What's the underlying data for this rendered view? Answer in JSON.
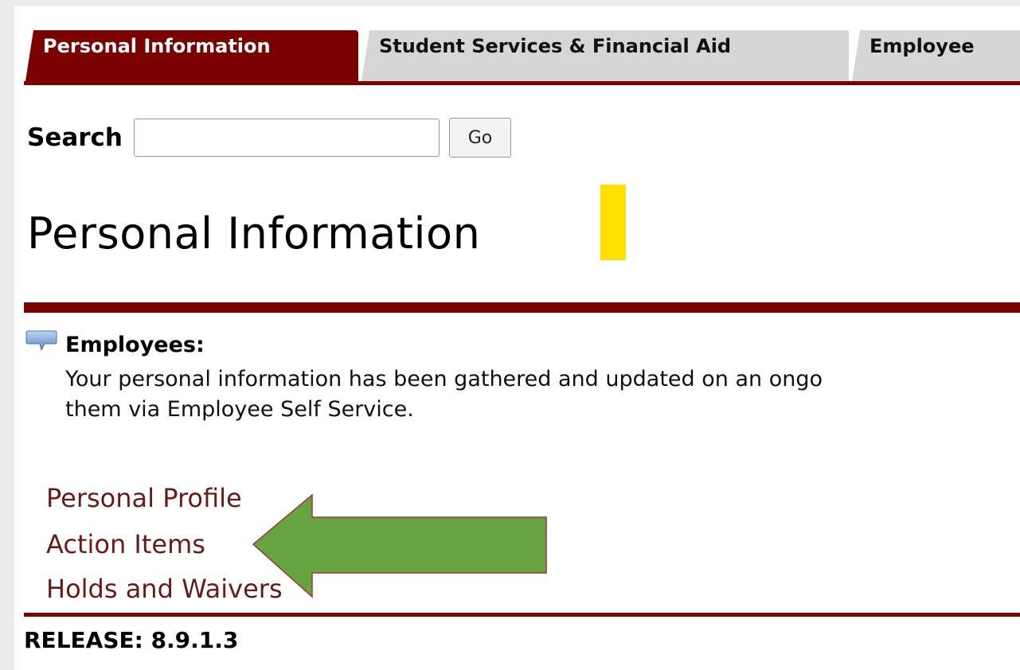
{
  "tabs": [
    {
      "label": "Personal Information",
      "active": true
    },
    {
      "label": "Student Services & Financial Aid",
      "active": false
    },
    {
      "label": "Employee",
      "active": false
    }
  ],
  "search": {
    "label": "Search",
    "value": "",
    "placeholder": "",
    "button_label": "Go"
  },
  "page_title": "Personal Information",
  "info": {
    "icon": "speech-bubble-icon",
    "heading": "Employees:",
    "line1": "Your personal information has been gathered and updated on an ongo",
    "line2": "them via Employee Self Service."
  },
  "links": [
    {
      "label": "Personal Profile"
    },
    {
      "label": "Action Items"
    },
    {
      "label": "Holds and Waivers"
    }
  ],
  "release": "RELEASE: 8.9.1.3",
  "colors": {
    "brand": "#7b0000",
    "tab_inactive": "#d6d6d6",
    "marker": "#ffe000",
    "arrow_fill": "#66a442",
    "arrow_stroke": "#a33434"
  }
}
